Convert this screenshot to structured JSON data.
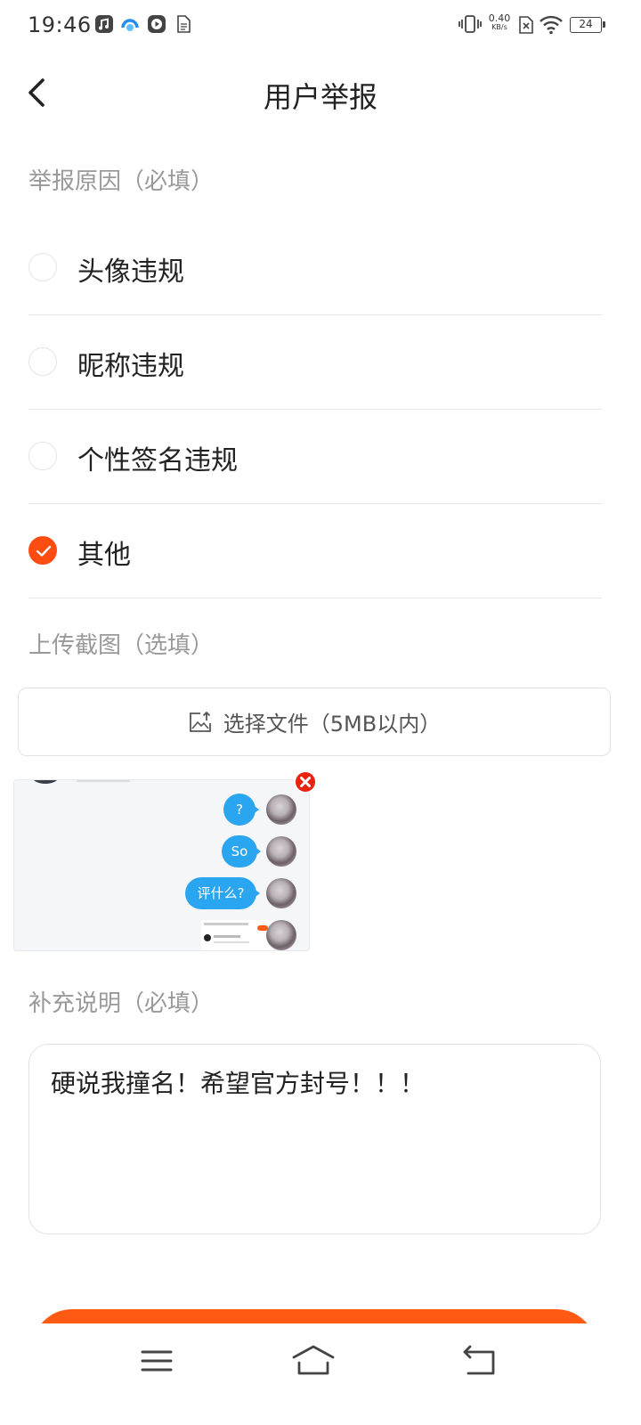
{
  "status_bar": {
    "time": "19:46",
    "net_speed_value": "0.40",
    "net_speed_unit": "KB/s",
    "battery": "24"
  },
  "header": {
    "title": "用户举报"
  },
  "reason_section": {
    "label": "举报原因（必填）",
    "options": [
      {
        "label": "头像违规",
        "checked": false
      },
      {
        "label": "昵称违规",
        "checked": false
      },
      {
        "label": "个性签名违规",
        "checked": false
      },
      {
        "label": "其他",
        "checked": true
      }
    ]
  },
  "upload_section": {
    "label": "上传截图（选填）",
    "button_label": "选择文件（5MB以内）",
    "thumbnail": {
      "bubbles": [
        "?",
        "So",
        "评什么?"
      ]
    }
  },
  "description_section": {
    "label": "补充说明（必填）",
    "value": "硬说我撞名！希望官方封号！！！"
  },
  "colors": {
    "accent": "#ff4d12",
    "remove": "#e8230f",
    "bubble": "#2aa6f0"
  }
}
